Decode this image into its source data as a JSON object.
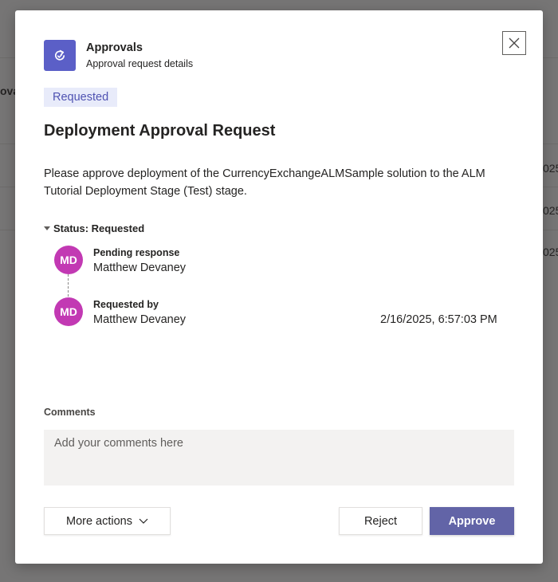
{
  "background": {
    "partial_label": "ova",
    "row_fragments": [
      "025",
      "025",
      "025"
    ]
  },
  "header": {
    "icon": "approvals-refresh-icon",
    "app_name": "Approvals",
    "subtitle": "Approval request details",
    "close_icon": "close-icon"
  },
  "request": {
    "status_badge": "Requested",
    "title": "Deployment Approval Request",
    "description": "Please approve deployment of the CurrencyExchangeALMSample solution to the ALM Tutorial Deployment Stage (Test) stage."
  },
  "status_section": {
    "toggle_label": "Status: Requested",
    "entries": [
      {
        "initials": "MD",
        "label": "Pending response",
        "name": "Matthew Devaney",
        "date": ""
      },
      {
        "initials": "MD",
        "label": "Requested by",
        "name": "Matthew Devaney",
        "date": "2/16/2025, 6:57:03 PM"
      }
    ]
  },
  "comments": {
    "label": "Comments",
    "placeholder": "Add your comments here",
    "value": ""
  },
  "actions": {
    "more_actions": "More actions",
    "reject": "Reject",
    "approve": "Approve"
  },
  "colors": {
    "accent": "#6264a7",
    "avatar": "#c239b3",
    "badge_bg": "#e8ebfa",
    "badge_text": "#4f52b2"
  }
}
